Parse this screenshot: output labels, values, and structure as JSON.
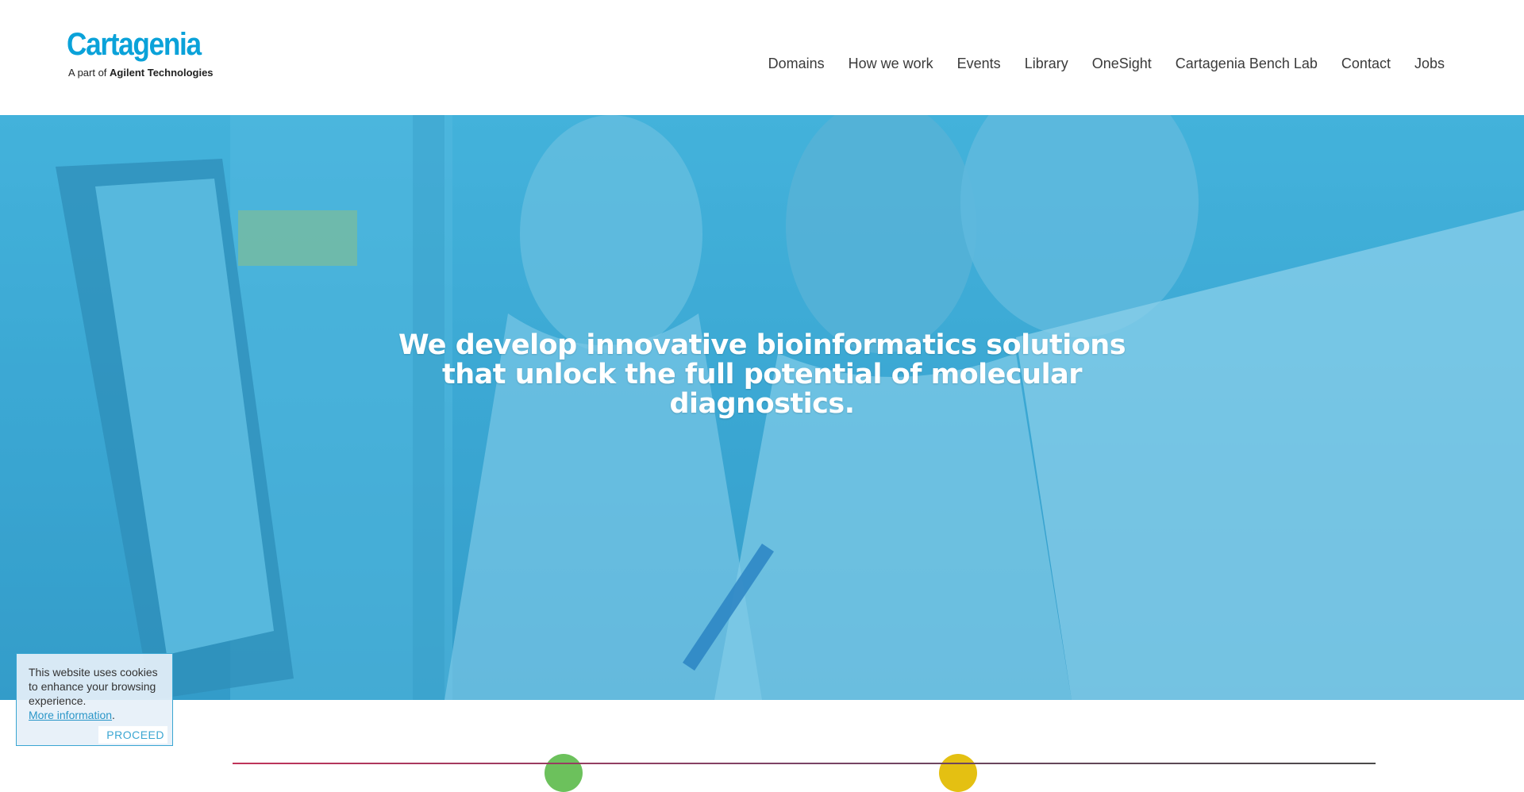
{
  "header": {
    "logo": {
      "name": "Cartagenia",
      "sub_prefix": "A part of",
      "sub_brand": "Agilent Technologies"
    },
    "nav": [
      "Domains",
      "How we work",
      "Events",
      "Library",
      "OneSight",
      "Cartagenia Bench Lab",
      "Contact",
      "Jobs"
    ]
  },
  "hero": {
    "lines": [
      "We develop innovative bioinformatics solutions",
      "that unlock the full potential of molecular",
      "diagnostics."
    ]
  },
  "cookie": {
    "message": "This website uses cookies to enhance your browsing experience.",
    "link": "More information",
    "button": "PROCEED"
  },
  "colors": {
    "brand": "#0aa2d9",
    "hero_overlay": "#3aa6d2"
  }
}
